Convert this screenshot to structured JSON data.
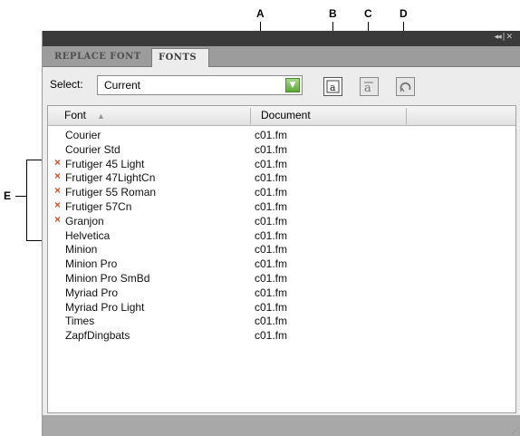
{
  "callouts": {
    "a": "A",
    "b": "B",
    "c": "C",
    "d": "D",
    "e": "E"
  },
  "panel": {
    "collapse_glyph": "◂◂ | ✕"
  },
  "tabs": {
    "replace_font": "REPLACE FONT",
    "fonts": "FONTS"
  },
  "select": {
    "label": "Select:",
    "value": "Current"
  },
  "toolbar": {
    "b_icon": "replace-font-icon",
    "c_icon": "font-case-icon",
    "d_icon": "refresh-icon"
  },
  "table": {
    "columns": [
      "Font",
      "Document"
    ],
    "rows": [
      {
        "font": "Courier",
        "document": "c01.fm",
        "missing": false
      },
      {
        "font": "Courier Std",
        "document": "c01.fm",
        "missing": false
      },
      {
        "font": "Frutiger 45 Light",
        "document": "c01.fm",
        "missing": true
      },
      {
        "font": "Frutiger 47LightCn",
        "document": "c01.fm",
        "missing": true
      },
      {
        "font": "Frutiger 55 Roman",
        "document": "c01.fm",
        "missing": true
      },
      {
        "font": "Frutiger 57Cn",
        "document": "c01.fm",
        "missing": true
      },
      {
        "font": "Granjon",
        "document": "c01.fm",
        "missing": true
      },
      {
        "font": "Helvetica",
        "document": "c01.fm",
        "missing": false
      },
      {
        "font": "Minion",
        "document": "c01.fm",
        "missing": false
      },
      {
        "font": "Minion Pro",
        "document": "c01.fm",
        "missing": false
      },
      {
        "font": "Minion Pro SmBd",
        "document": "c01.fm",
        "missing": false
      },
      {
        "font": "Myriad Pro",
        "document": "c01.fm",
        "missing": false
      },
      {
        "font": "Myriad Pro Light",
        "document": "c01.fm",
        "missing": false
      },
      {
        "font": "Times",
        "document": "c01.fm",
        "missing": false
      },
      {
        "font": "ZapfDingbats",
        "document": "c01.fm",
        "missing": false
      }
    ]
  },
  "colors": {
    "missing_marker": "#e0502a",
    "select_arrow": "#5da83a",
    "titlebar": "#3a3a3a"
  }
}
